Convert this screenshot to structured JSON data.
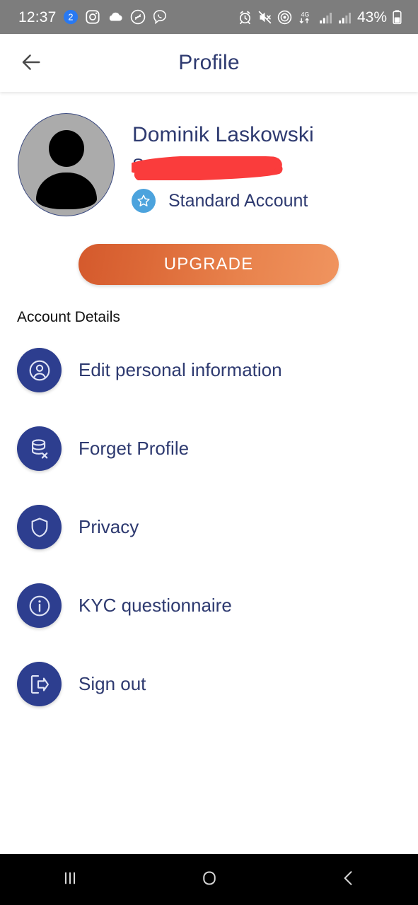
{
  "status_bar": {
    "time": "12:37",
    "battery_percent": "43%",
    "left_icons": [
      {
        "name": "notification-badge-icon",
        "label": "2"
      },
      {
        "name": "instagram-icon",
        "label": ""
      },
      {
        "name": "cloud-icon",
        "label": ""
      },
      {
        "name": "shazam-icon",
        "label": ""
      },
      {
        "name": "viber-icon",
        "label": ""
      }
    ],
    "right_icons": [
      {
        "name": "alarm-clock-icon",
        "label": ""
      },
      {
        "name": "mute-vibrate-icon",
        "label": ""
      },
      {
        "name": "hotspot-icon",
        "label": ""
      },
      {
        "name": "network-4g-icon",
        "label": "4G"
      },
      {
        "name": "signal-bars-sim1-icon",
        "label": ""
      },
      {
        "name": "signal-bars-sim2-icon",
        "label": ""
      },
      {
        "name": "battery-icon",
        "label": ""
      }
    ],
    "background_color": "#7d7d7d",
    "text_color": "#ffffff"
  },
  "header": {
    "title": "Profile",
    "back_icon": "arrow-left-icon",
    "title_color": "#2e3a70"
  },
  "profile": {
    "avatar_icon": "user-avatar-placeholder",
    "name": "Dominik Laskowski",
    "email": "S",
    "email_redacted": true,
    "redaction_color": "#fa3c3c",
    "account_type": "Standard Account",
    "account_badge_icon": "star-icon",
    "badge_color": "#4ca3dd"
  },
  "upgrade": {
    "label": "UPGRADE",
    "gradient_from": "#d4592c",
    "gradient_to": "#f0945f",
    "text_color": "#ffffff"
  },
  "section": {
    "label": "Account Details"
  },
  "menu": {
    "icon_color": "#2d3e8f",
    "items": [
      {
        "label": "Edit personal information",
        "icon": "user-circle-icon"
      },
      {
        "label": "Forget Profile",
        "icon": "database-remove-icon"
      },
      {
        "label": "Privacy",
        "icon": "shield-icon"
      },
      {
        "label": "KYC questionnaire",
        "icon": "info-circle-icon"
      },
      {
        "label": "Sign out",
        "icon": "logout-icon"
      }
    ]
  },
  "nav_bar": {
    "recents_icon": "recents-icon",
    "home_icon": "home-icon",
    "back_icon": "back-chevron-icon",
    "background_color": "#000000"
  }
}
